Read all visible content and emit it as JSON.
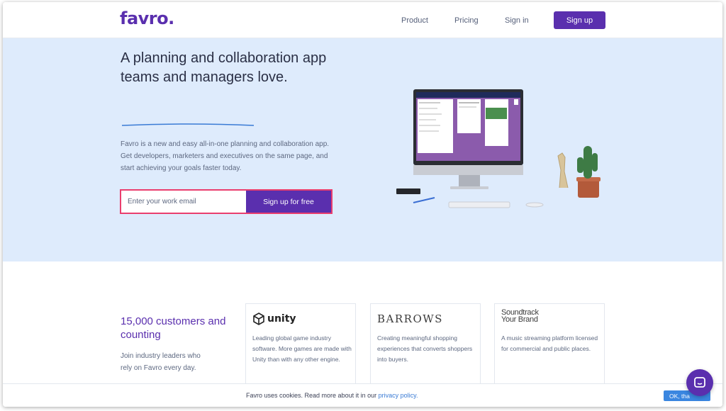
{
  "header": {
    "logo": "favro.",
    "nav": {
      "product": "Product",
      "pricing": "Pricing",
      "signin": "Sign in"
    },
    "signup_label": "Sign up"
  },
  "hero": {
    "title_line1": "A planning and collaboration app",
    "title_line2": "teams and managers love.",
    "description": "Favro is a new and easy all-in-one planning and collaboration app. Get developers, marketers and executives on the same page, and start achieving your goals faster today.",
    "email_placeholder": "Enter your work email",
    "cta_label": "Sign up for free"
  },
  "customers": {
    "title": "15,000 customers and counting",
    "description": "Join industry leaders who rely on Favro every day.",
    "cards": [
      {
        "logo": "unity",
        "text": "Leading global game industry software. More games are made with Unity than with any other engine."
      },
      {
        "logo": "BARROWS",
        "text": "Creating meaningful shopping experiences that converts shoppers into buyers."
      },
      {
        "logo_line1": "Soundtrack",
        "logo_line2": "Your Brand",
        "text": "A music streaming platform licensed for commercial and public places."
      }
    ]
  },
  "cookie": {
    "text": "Favro uses cookies. Read more about it in our ",
    "link": "privacy policy.",
    "ok_label": "OK, tha"
  },
  "colors": {
    "brand": "#5a2fae",
    "hero_bg": "#deebfc",
    "accent_pink": "#ea3e6e",
    "link": "#3a7bd5"
  },
  "icons": {
    "chat": "chat-bubble-icon",
    "unity": "unity-cube-icon"
  }
}
